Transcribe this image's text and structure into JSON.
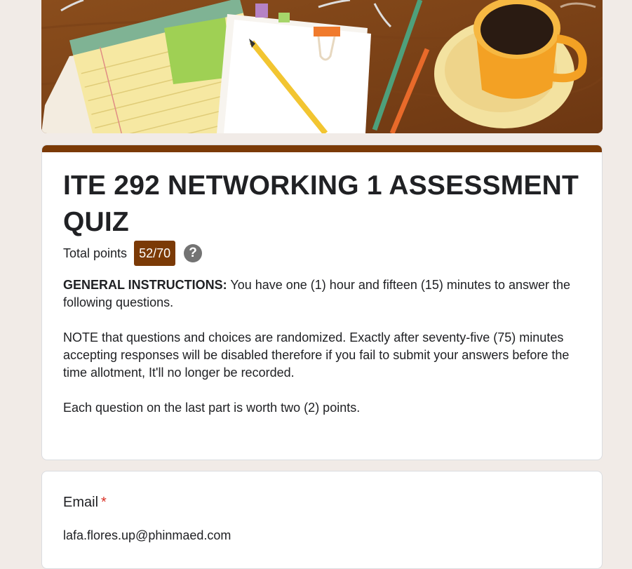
{
  "form": {
    "title": "ITE 292 NETWORKING 1 ASSESSMENT QUIZ",
    "points_label": "Total points",
    "score": "52/70",
    "help_glyph": "?",
    "instructions_heading": "GENERAL INSTRUCTIONS:",
    "instructions_text": " You have one (1) hour and fifteen (15) minutes to answer the following questions.",
    "note": "NOTE that questions and choices are randomized. Exactly after seventy-five (75) minutes accepting responses will be disabled therefore if you fail to submit your answers before the time allotment, It'll no longer be recorded.",
    "points_note": "Each question on the last part is worth two (2) points."
  },
  "email": {
    "label": "Email",
    "required_mark": "*",
    "value": "lafa.flores.up@phinmaed.com"
  },
  "colors": {
    "accent": "#7b3a06",
    "background": "#f1ebe7",
    "required": "#d93025"
  },
  "icons": {
    "help": "help-circle-icon"
  }
}
